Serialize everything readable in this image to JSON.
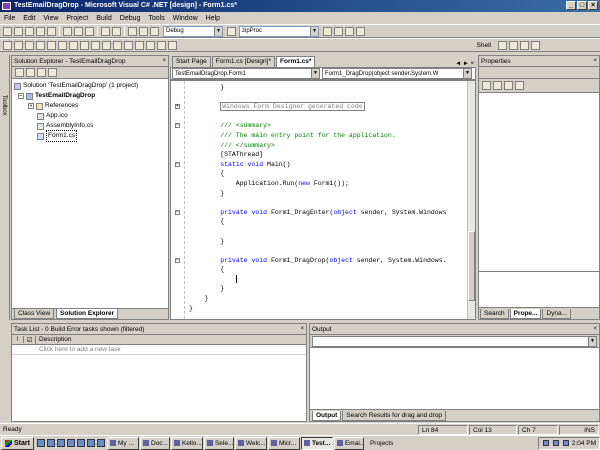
{
  "window": {
    "title": "TestEmailDragDrop - Microsoft Visual C# .NET [design] - Form1.cs*",
    "min": "_",
    "max": "□",
    "close": "×"
  },
  "menu": [
    "File",
    "Edit",
    "View",
    "Project",
    "Build",
    "Debug",
    "Tools",
    "Window",
    "Help"
  ],
  "toolbar": {
    "config": "Debug",
    "find": "zipProc",
    "shell": "Shell"
  },
  "solution_explorer": {
    "title": "Solution Explorer - TestEmailDragDrop",
    "items": [
      {
        "label": "Solution 'TestEmailDragDrop' (1 project)"
      },
      {
        "label": "TestEmailDragDrop"
      },
      {
        "label": "References"
      },
      {
        "label": "App.ico"
      },
      {
        "label": "AssemblyInfo.cs"
      },
      {
        "label": "Form1.cs"
      }
    ],
    "tabs": [
      "Class View",
      "Solution Explorer"
    ]
  },
  "toolbox_label": "Toolbox",
  "editor": {
    "tabs": [
      "Start Page",
      "Form1.cs [Design]*",
      "Form1.cs*"
    ],
    "class_combo": "TestEmailDragDrop.Form1",
    "member_combo": "Form1_DragDrop(object sender,System.W",
    "lines": [
      {
        "t": "        }",
        "c": ""
      },
      {
        "t": "",
        "c": ""
      },
      {
        "t": "        Windows Form Designer generated code",
        "c": "region"
      },
      {
        "t": "",
        "c": ""
      },
      {
        "t": "        /// <summary>",
        "c": "cm"
      },
      {
        "t": "        /// The main entry point for the application.",
        "c": "cm"
      },
      {
        "t": "        /// </summary>",
        "c": "cm"
      },
      {
        "t": "        [STAThread]",
        "c": ""
      },
      {
        "t": "        static void Main()",
        "c": "kw2"
      },
      {
        "t": "        {",
        "c": ""
      },
      {
        "t": "            Application.Run(new Form1());",
        "c": "kw3"
      },
      {
        "t": "        }",
        "c": ""
      },
      {
        "t": "",
        "c": ""
      },
      {
        "t": "        private void Form1_DragEnter(object sender, System.Windows",
        "c": "kw4"
      },
      {
        "t": "        {",
        "c": ""
      },
      {
        "t": "",
        "c": ""
      },
      {
        "t": "        }",
        "c": ""
      },
      {
        "t": "",
        "c": ""
      },
      {
        "t": "        private void Form1_DragDrop(object sender, System.Windows.",
        "c": "kw4"
      },
      {
        "t": "        {",
        "c": ""
      },
      {
        "t": "            |",
        "c": "cursor"
      },
      {
        "t": "        }",
        "c": ""
      },
      {
        "t": "    }",
        "c": ""
      },
      {
        "t": "}",
        "c": ""
      }
    ]
  },
  "properties": {
    "title": "Properties",
    "tabs": [
      "Search",
      "Prope...",
      "Dyna..."
    ]
  },
  "tasklist": {
    "title": "Task List - 0 Build Error tasks shown (filtered)",
    "col_desc": "Description",
    "placeholder": "Click here to add a new task"
  },
  "output": {
    "title": "Output",
    "tabs": [
      "Output",
      "Search Results for drag and drop"
    ]
  },
  "status": {
    "ready": "Ready",
    "ln": "Ln 84",
    "col": "Col 13",
    "ch": "Ch 7",
    "ins": "INS"
  },
  "taskbar": {
    "start": "Start",
    "tasks": [
      "My ...",
      "Doc...",
      "Kello...",
      "Sele...",
      "Welc...",
      "Micr...",
      "Test...",
      "Emai..."
    ],
    "projects": "Projects",
    "time": "2:04 PM"
  }
}
